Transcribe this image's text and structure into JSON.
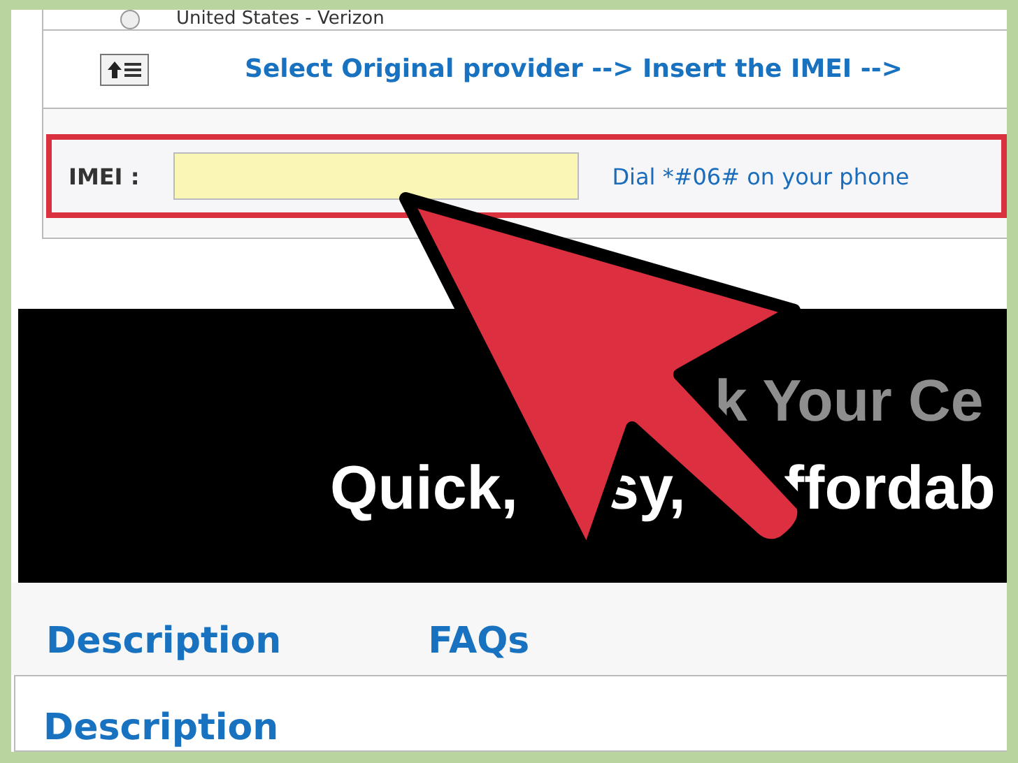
{
  "carrier_list": {
    "option": {
      "label": "United States - Verizon",
      "selected": false
    }
  },
  "instructions": {
    "text": "Select Original provider --> Insert the IMEI -->"
  },
  "imei_field": {
    "label": "IMEI :",
    "hint": "Dial *#06# on your phone"
  },
  "banner": {
    "lines": [
      {
        "kind": "heading",
        "segments": [
          "k Your Ce"
        ]
      },
      {
        "kind": "tagline",
        "segments": [
          "Quick,",
          "sy,",
          "ffordab"
        ]
      }
    ]
  },
  "tabs": [
    {
      "label": "Description"
    },
    {
      "label": "FAQs"
    }
  ],
  "content": {
    "heading": "Description"
  }
}
